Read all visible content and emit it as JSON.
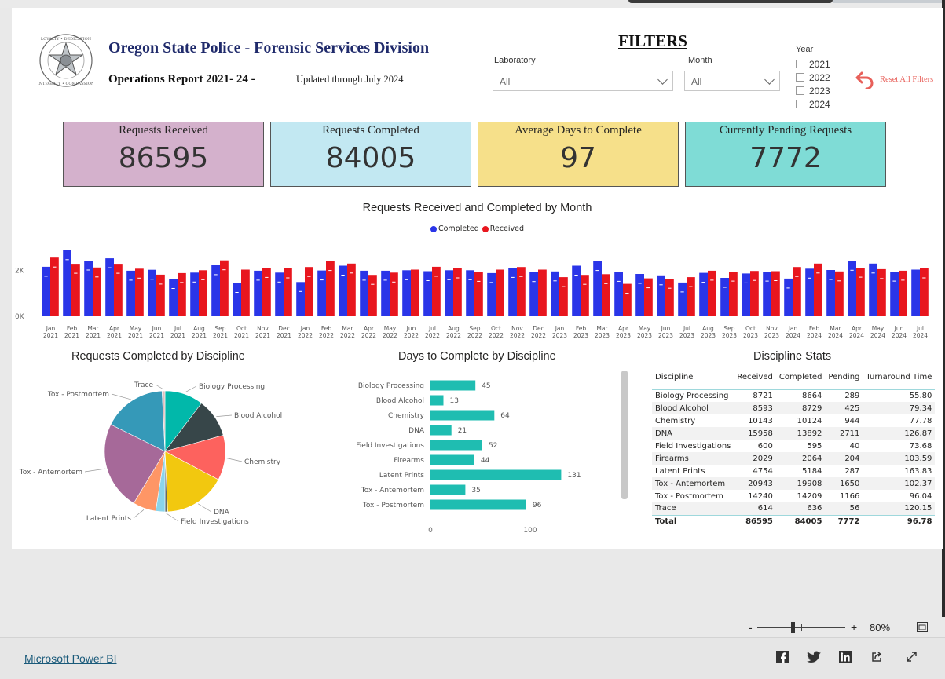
{
  "header": {
    "org_title": "Oregon State Police - Forensic Services Division",
    "report_title": "Operations Report 2021- 24 -",
    "updated": "Updated through July 2024",
    "badge_icon": "osp-star-badge-icon"
  },
  "filters": {
    "title": "FILTERS",
    "laboratory_label": "Laboratory",
    "laboratory_value": "All",
    "month_label": "Month",
    "month_value": "All",
    "year_label": "Year",
    "years": [
      "2021",
      "2022",
      "2023",
      "2024"
    ],
    "reset_label": "Reset All Filters",
    "reset_color": "#e8605a"
  },
  "kpis": [
    {
      "title": "Requests Received",
      "value": "86595",
      "color": "#d4b1cc"
    },
    {
      "title": "Requests Completed",
      "value": "84005",
      "color": "#c2e8f2"
    },
    {
      "title": "Average Days to Complete",
      "value": "97",
      "color": "#f6e08a"
    },
    {
      "title": "Currently Pending Requests",
      "value": "7772",
      "color": "#7fdcd6"
    }
  ],
  "chart_data": [
    {
      "type": "bar",
      "title": "Requests Received and Completed by Month",
      "series": [
        {
          "name": "Completed",
          "color": "#2a35e8",
          "values": [
            2150,
            2870,
            2420,
            2520,
            1980,
            2020,
            1620,
            1900,
            2220,
            1450,
            1980,
            1900,
            1490,
            1990,
            2200,
            1980,
            1980,
            2000,
            1960,
            2000,
            2000,
            1880,
            2100,
            1920,
            1950,
            2200,
            2400,
            1930,
            1840,
            1780,
            1470,
            1890,
            1670,
            1860,
            1940,
            1640,
            2070,
            2010,
            2410,
            2290,
            1940,
            2030
          ]
        },
        {
          "name": "Received",
          "color": "#e8161e",
          "values": [
            2550,
            2280,
            2120,
            2280,
            2070,
            1810,
            1880,
            2000,
            2430,
            2030,
            2100,
            2080,
            2140,
            2400,
            2290,
            1800,
            1900,
            2030,
            2150,
            2080,
            1930,
            2030,
            2140,
            2030,
            1700,
            1800,
            1830,
            1410,
            1650,
            1630,
            1700,
            1980,
            1940,
            1970,
            1960,
            2140,
            2290,
            1950,
            2110,
            2050,
            1980,
            2080
          ]
        }
      ],
      "categories": [
        [
          "Jan",
          "2021"
        ],
        [
          "Feb",
          "2021"
        ],
        [
          "Mar",
          "2021"
        ],
        [
          "Apr",
          "2021"
        ],
        [
          "May",
          "2021"
        ],
        [
          "Jun",
          "2021"
        ],
        [
          "Jul",
          "2021"
        ],
        [
          "Aug",
          "2021"
        ],
        [
          "Sep",
          "2021"
        ],
        [
          "Oct",
          "2021"
        ],
        [
          "Nov",
          "2021"
        ],
        [
          "Dec",
          "2021"
        ],
        [
          "Jan",
          "2022"
        ],
        [
          "Feb",
          "2022"
        ],
        [
          "Mar",
          "2022"
        ],
        [
          "Apr",
          "2022"
        ],
        [
          "May",
          "2022"
        ],
        [
          "Jun",
          "2022"
        ],
        [
          "Jul",
          "2022"
        ],
        [
          "Aug",
          "2022"
        ],
        [
          "Sep",
          "2022"
        ],
        [
          "Oct",
          "2022"
        ],
        [
          "Nov",
          "2022"
        ],
        [
          "Dec",
          "2022"
        ],
        [
          "Jan",
          "2023"
        ],
        [
          "Feb",
          "2023"
        ],
        [
          "Mar",
          "2023"
        ],
        [
          "Apr",
          "2023"
        ],
        [
          "May",
          "2023"
        ],
        [
          "Jun",
          "2023"
        ],
        [
          "Jul",
          "2023"
        ],
        [
          "Aug",
          "2023"
        ],
        [
          "Sep",
          "2023"
        ],
        [
          "Oct",
          "2023"
        ],
        [
          "Nov",
          "2023"
        ],
        [
          "Jan",
          "2024"
        ],
        [
          "Feb",
          "2024"
        ],
        [
          "Mar",
          "2024"
        ],
        [
          "Apr",
          "2024"
        ],
        [
          "May",
          "2024"
        ],
        [
          "Jun",
          "2024"
        ],
        [
          "Jul",
          "2024"
        ]
      ],
      "yticks": [
        "0K",
        "2K"
      ],
      "ylim": [
        0,
        3000
      ],
      "legend_position": "top-center"
    },
    {
      "type": "pie",
      "title": "Requests Completed by Discipline",
      "slices": [
        {
          "label": "Biology Processing",
          "value": 8664,
          "color": "#01b8aa"
        },
        {
          "label": "Blood Alcohol",
          "value": 8729,
          "color": "#374649"
        },
        {
          "label": "Chemistry",
          "value": 10124,
          "color": "#fd625e"
        },
        {
          "label": "DNA",
          "value": 13892,
          "color": "#f2c80f"
        },
        {
          "label": "Field Investigations",
          "value": 595,
          "color": "#5f6b6d"
        },
        {
          "label": "Firearms",
          "value": 2064,
          "color": "#8ad4eb"
        },
        {
          "label": "Latent Prints",
          "value": 5184,
          "color": "#fe9666"
        },
        {
          "label": "Tox - Antemortem",
          "value": 19908,
          "color": "#a66999"
        },
        {
          "label": "Tox - Postmortem",
          "value": 14209,
          "color": "#3599b8"
        },
        {
          "label": "Trace",
          "value": 636,
          "color": "#dfbfbf"
        }
      ]
    },
    {
      "type": "bar",
      "orientation": "horizontal",
      "title": "Days to Complete by Discipline",
      "categories": [
        "Biology Processing",
        "Blood Alcohol",
        "Chemistry",
        "DNA",
        "Field Investigations",
        "Firearms",
        "Latent Prints",
        "Tox - Antemortem",
        "Tox - Postmortem"
      ],
      "values": [
        45,
        13,
        64,
        21,
        52,
        44,
        131,
        35,
        96
      ],
      "color": "#1fbdb1",
      "xticks": [
        "0",
        "100"
      ],
      "xlim": [
        0,
        150
      ]
    },
    {
      "type": "table",
      "title": "Discipline Stats",
      "columns": [
        "Discipline",
        "Received",
        "Completed",
        "Pending",
        "Turnaround Time"
      ],
      "rows": [
        [
          "Biology Processing",
          "8721",
          "8664",
          "289",
          "55.80"
        ],
        [
          "Blood Alcohol",
          "8593",
          "8729",
          "425",
          "79.34"
        ],
        [
          "Chemistry",
          "10143",
          "10124",
          "944",
          "77.78"
        ],
        [
          "DNA",
          "15958",
          "13892",
          "2711",
          "126.87"
        ],
        [
          "Field Investigations",
          "600",
          "595",
          "40",
          "73.68"
        ],
        [
          "Firearms",
          "2029",
          "2064",
          "204",
          "103.59"
        ],
        [
          "Latent Prints",
          "4754",
          "5184",
          "287",
          "163.83"
        ],
        [
          "Tox - Antemortem",
          "20943",
          "19908",
          "1650",
          "102.37"
        ],
        [
          "Tox - Postmortem",
          "14240",
          "14209",
          "1166",
          "96.04"
        ],
        [
          "Trace",
          "614",
          "636",
          "56",
          "120.15"
        ]
      ],
      "total": [
        "Total",
        "86595",
        "84005",
        "7772",
        "96.78"
      ]
    }
  ],
  "zoom": {
    "minus": "-",
    "plus": "+",
    "level": "80%",
    "fit_icon": "fit-to-page-icon"
  },
  "footer": {
    "link": "Microsoft Power BI",
    "icons": [
      "facebook-icon",
      "twitter-icon",
      "linkedin-icon",
      "share-icon",
      "fullscreen-icon"
    ]
  }
}
